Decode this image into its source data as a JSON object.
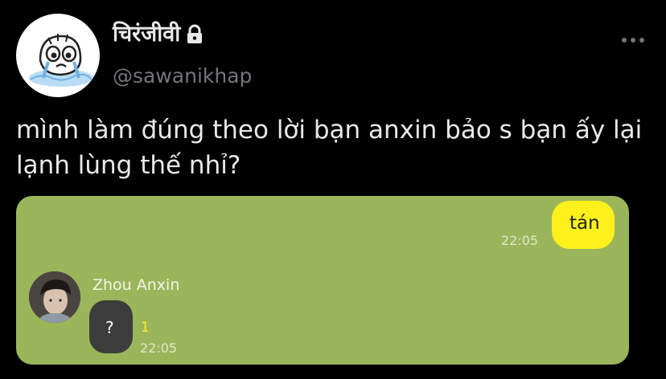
{
  "tweet": {
    "author": {
      "display_name": "चिरंजीवी",
      "handle": "@sawanikhap",
      "avatar_icon": "cartoon-crying-face-icon",
      "locked_icon": "lock-icon"
    },
    "more_icon": "more-horizontal-icon",
    "text": "mình làm đúng theo lời bạn anxin bảo s bạn ấy lại lạnh lùng thế nhỉ?"
  },
  "chat_screenshot": {
    "background_color": "#9bb55b",
    "sent_message": {
      "text": "tán",
      "time": "22:05",
      "bubble_color": "#fef01b"
    },
    "received_message": {
      "sender_name": "Zhou Anxin",
      "text": "?",
      "unread_count": "1",
      "time": "22:05",
      "bubble_color": "#3c3c3c"
    }
  }
}
